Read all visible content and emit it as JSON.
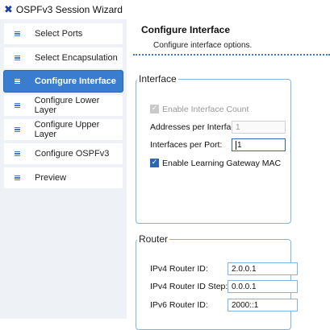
{
  "window": {
    "title": "OSPFv3 Session Wizard",
    "icon": "x-logo-icon",
    "accent_color": "#3a7dd0"
  },
  "sidebar": {
    "items": [
      {
        "label": "Select Ports",
        "active": false
      },
      {
        "label": "Select Encapsulation",
        "active": false
      },
      {
        "label": "Configure Interface",
        "active": true
      },
      {
        "label": "Configure Lower Layer",
        "active": false
      },
      {
        "label": "Configure Upper Layer",
        "active": false
      },
      {
        "label": "Configure OSPFv3",
        "active": false
      },
      {
        "label": "Preview",
        "active": false
      }
    ]
  },
  "header": {
    "title": "Configure Interface",
    "subtitle": "Configure interface options."
  },
  "interface_group": {
    "legend": "Interface",
    "enable_interface_count": {
      "label": "Enable Interface Count",
      "checked": true,
      "enabled": false
    },
    "addresses_per_interface": {
      "label": "Addresses per Interface:",
      "value": "1",
      "enabled": false
    },
    "interfaces_per_port": {
      "label": "Interfaces per Port:",
      "value": "1",
      "enabled": true
    },
    "enable_learning_gateway_mac": {
      "label": "Enable Learning Gateway MAC",
      "checked": true,
      "enabled": true
    }
  },
  "router_group": {
    "legend": "Router",
    "ipv4_router_id": {
      "label": "IPv4 Router ID:",
      "value": "2.0.0.1"
    },
    "ipv4_router_id_step": {
      "label": "IPv4 Router ID Step:",
      "value": "0.0.0.1"
    },
    "ipv6_router_id": {
      "label": "IPv6 Router ID:",
      "value": "2000::1"
    }
  }
}
